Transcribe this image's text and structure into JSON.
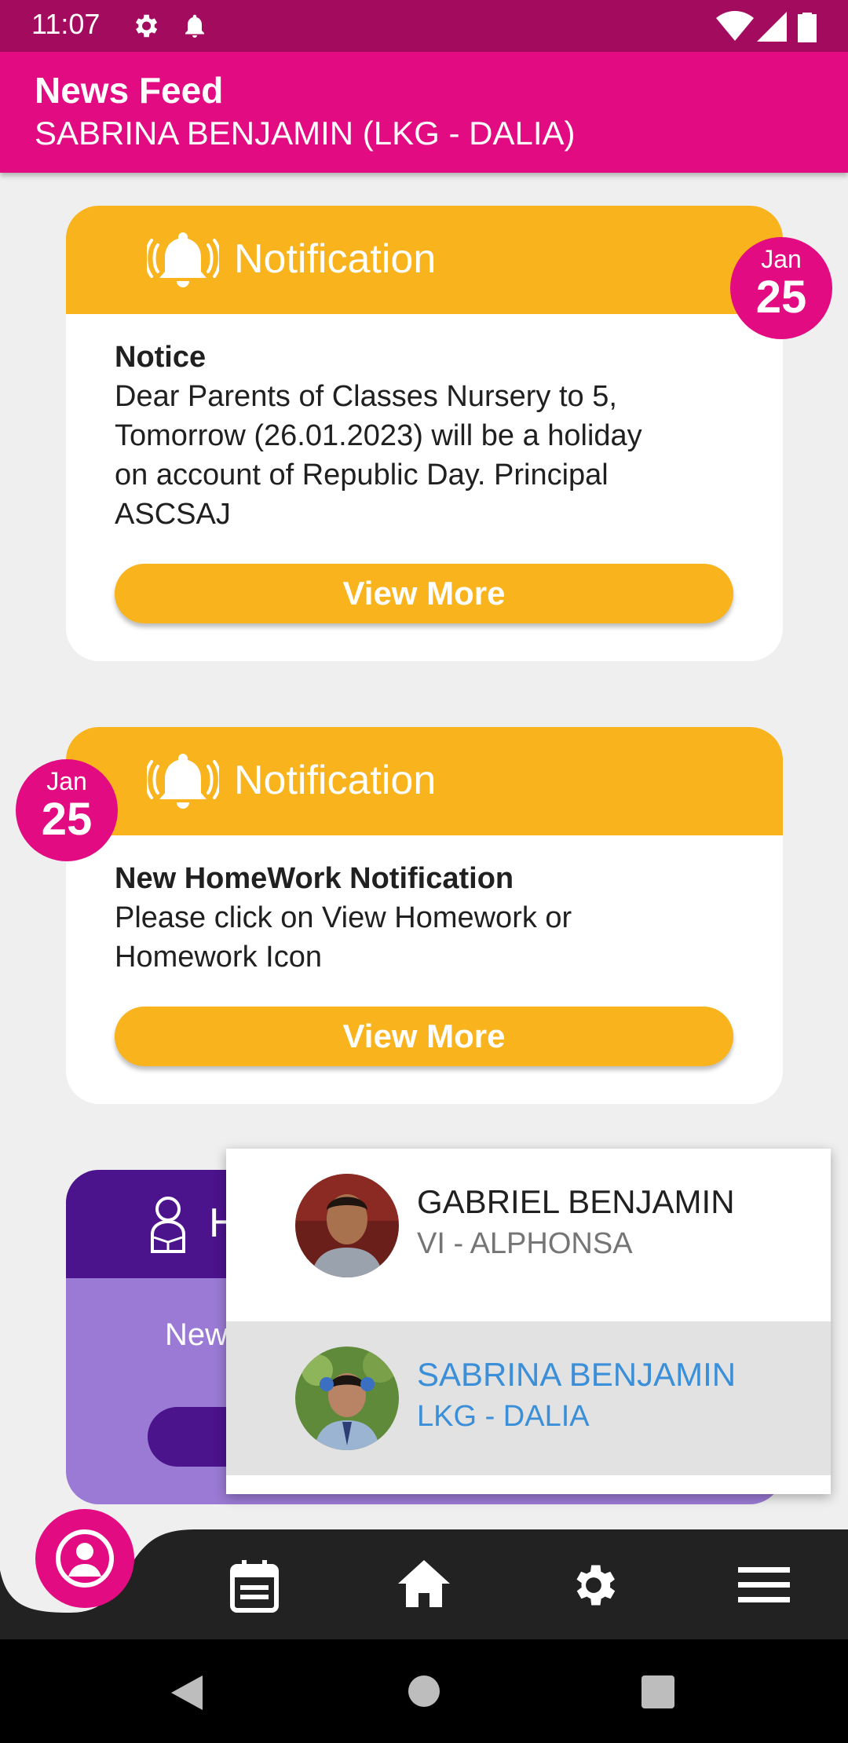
{
  "status_bar": {
    "time": "11:07",
    "icons": [
      "settings-icon",
      "notification-bell-icon",
      "wifi-icon",
      "signal-icon",
      "battery-icon"
    ]
  },
  "app_bar": {
    "title": "News Feed",
    "subtitle": "SABRINA BENJAMIN (LKG - DALIA)"
  },
  "feed": [
    {
      "header": "Notification",
      "icon": "ringing-bell-icon",
      "date_month": "Jan",
      "date_day": "25",
      "body_title": "Notice",
      "body_lines": [
        "Dear Parents of Classes Nursery to 5,",
        "Tomorrow (26.01.2023) will be a holiday",
        "on account of Republic Day. Principal",
        "ASCSAJ"
      ],
      "button": "View More"
    },
    {
      "header": "Notification",
      "icon": "ringing-bell-icon",
      "date_month": "Jan",
      "date_day": "25",
      "body_title": "New HomeWork Notification",
      "body_lines": [
        "Please click on View Homework or",
        "Homework Icon"
      ],
      "button": "View More"
    },
    {
      "header_partial": "H",
      "icon": "reading-student-icon",
      "body_partial": "New"
    }
  ],
  "student_switcher": {
    "items": [
      {
        "name": "GABRIEL BENJAMIN",
        "class": "VI - ALPHONSA",
        "selected": false
      },
      {
        "name": "SABRINA BENJAMIN",
        "class": "LKG - DALIA",
        "selected": true
      }
    ]
  },
  "bottom_nav": {
    "items": [
      "profile-icon",
      "calendar-icon",
      "home-icon",
      "settings-icon",
      "menu-icon"
    ]
  },
  "colors": {
    "status_bar": "#a30b5e",
    "primary": "#e30b82",
    "notification_header": "#f9b31c",
    "homework_header": "#4b138c",
    "homework_body": "#9a7ad4",
    "selected_text": "#3b8fd9"
  }
}
